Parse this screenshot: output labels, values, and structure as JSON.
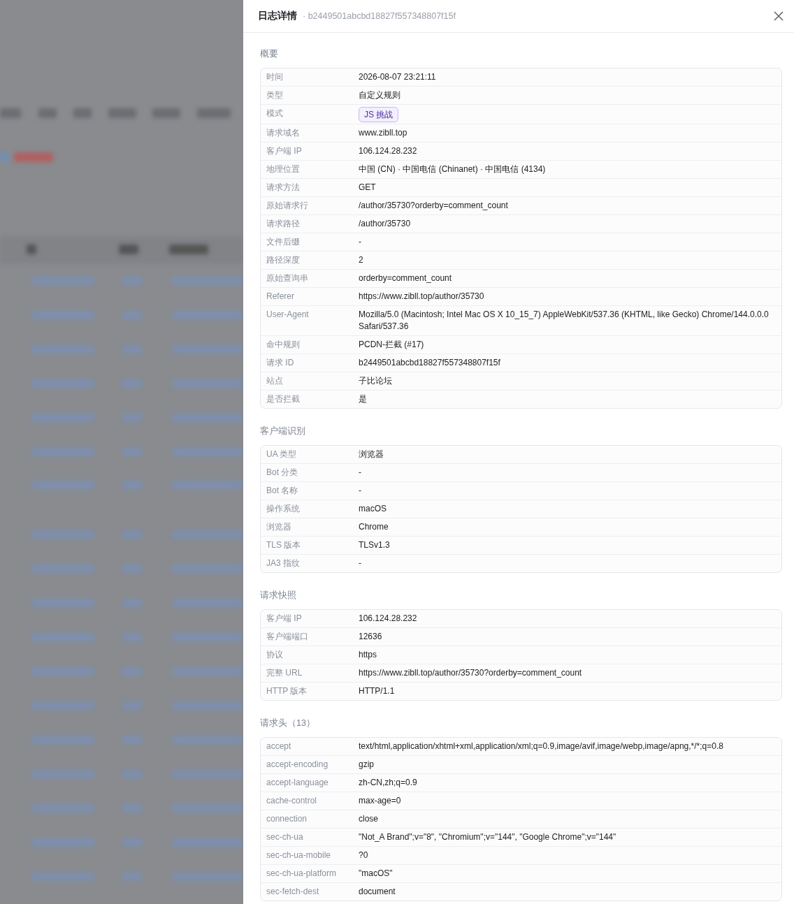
{
  "drawer": {
    "title": "日志详情",
    "subtitle": "· b2449501abcbd18827f557348807f15f"
  },
  "sections": [
    {
      "title": "概要",
      "rows": [
        {
          "label": "时间",
          "value": "2026-08-07 23:21:11",
          "kind": "text"
        },
        {
          "label": "类型",
          "value": "自定义规则",
          "kind": "text"
        },
        {
          "label": "模式",
          "value": "JS 挑战",
          "kind": "badge"
        },
        {
          "label": "请求域名",
          "value": "www.zibll.top",
          "kind": "text"
        },
        {
          "label": "客户端 IP",
          "value": "106.124.28.232",
          "kind": "text"
        },
        {
          "label": "地理位置",
          "value": "中国 (CN) · 中国电信 (Chinanet) · 中国电信 (4134)",
          "kind": "text"
        },
        {
          "label": "请求方法",
          "value": "GET",
          "kind": "text"
        },
        {
          "label": "原始请求行",
          "value": "/author/35730?orderby=comment_count",
          "kind": "text"
        },
        {
          "label": "请求路径",
          "value": "/author/35730",
          "kind": "text"
        },
        {
          "label": "文件后缀",
          "value": "-",
          "kind": "text"
        },
        {
          "label": "路径深度",
          "value": "2",
          "kind": "text"
        },
        {
          "label": "原始查询串",
          "value": "orderby=comment_count",
          "kind": "text"
        },
        {
          "label": "Referer",
          "value": "https://www.zibll.top/author/35730",
          "kind": "text"
        },
        {
          "label": "User-Agent",
          "value": "Mozilla/5.0 (Macintosh; Intel Mac OS X 10_15_7) AppleWebKit/537.36 (KHTML, like Gecko) Chrome/144.0.0.0 Safari/537.36",
          "kind": "text"
        },
        {
          "label": "命中规则",
          "value": "PCDN-拦截 (#17)",
          "kind": "text"
        },
        {
          "label": "请求 ID",
          "value": "b2449501abcbd18827f557348807f15f",
          "kind": "text"
        },
        {
          "label": "站点",
          "value": "子比论坛",
          "kind": "text"
        },
        {
          "label": "是否拦截",
          "value": "是",
          "kind": "text"
        }
      ]
    },
    {
      "title": "客户端识别",
      "rows": [
        {
          "label": "UA 类型",
          "value": "浏览器",
          "kind": "text"
        },
        {
          "label": "Bot 分类",
          "value": "-",
          "kind": "text"
        },
        {
          "label": "Bot 名称",
          "value": "-",
          "kind": "text"
        },
        {
          "label": "操作系统",
          "value": "macOS",
          "kind": "text"
        },
        {
          "label": "浏览器",
          "value": "Chrome",
          "kind": "text"
        },
        {
          "label": "TLS 版本",
          "value": "TLSv1.3",
          "kind": "text"
        },
        {
          "label": "JA3 指纹",
          "value": "-",
          "kind": "text"
        }
      ]
    },
    {
      "title": "请求快照",
      "rows": [
        {
          "label": "客户端 IP",
          "value": "106.124.28.232",
          "kind": "text"
        },
        {
          "label": "客户端端口",
          "value": "12636",
          "kind": "text"
        },
        {
          "label": "协议",
          "value": "https",
          "kind": "text"
        },
        {
          "label": "完整 URL",
          "value": "https://www.zibll.top/author/35730?orderby=comment_count",
          "kind": "text"
        },
        {
          "label": "HTTP 版本",
          "value": "HTTP/1.1",
          "kind": "text"
        }
      ]
    },
    {
      "title": "请求头（13）",
      "rows": [
        {
          "label": "accept",
          "value": "text/html,application/xhtml+xml,application/xml;q=0.9,image/avif,image/webp,image/apng,*/*;q=0.8",
          "kind": "text"
        },
        {
          "label": "accept-encoding",
          "value": "gzip",
          "kind": "text"
        },
        {
          "label": "accept-language",
          "value": "zh-CN,zh;q=0.9",
          "kind": "text"
        },
        {
          "label": "cache-control",
          "value": "max-age=0",
          "kind": "text"
        },
        {
          "label": "connection",
          "value": "close",
          "kind": "text"
        },
        {
          "label": "sec-ch-ua",
          "value": "\"Not_A Brand\";v=\"8\", \"Chromium\";v=\"144\", \"Google Chrome\";v=\"144\"",
          "kind": "text"
        },
        {
          "label": "sec-ch-ua-mobile",
          "value": "?0",
          "kind": "text"
        },
        {
          "label": "sec-ch-ua-platform",
          "value": "\"macOS\"",
          "kind": "text"
        },
        {
          "label": "sec-fetch-dest",
          "value": "document",
          "kind": "text"
        }
      ]
    }
  ]
}
